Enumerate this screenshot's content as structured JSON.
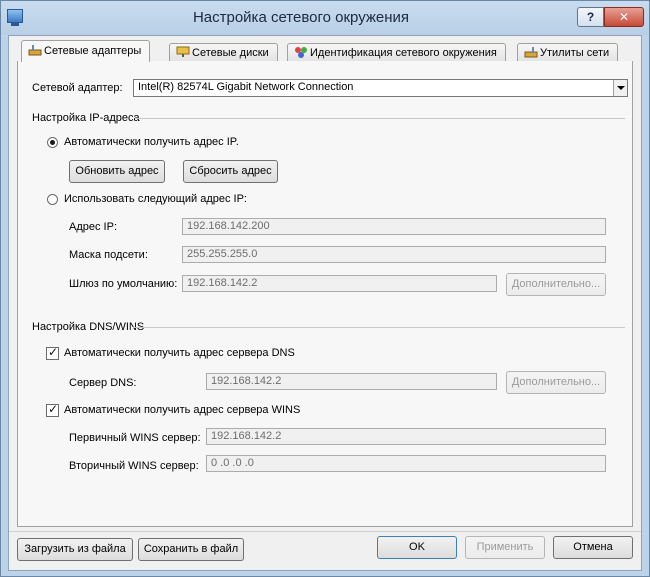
{
  "window": {
    "title": "Настройка сетевого окружения",
    "help_label": "?",
    "close_label": "✕"
  },
  "tabs": [
    {
      "label": "Сетевые адаптеры",
      "icon": "network-adapter-icon",
      "active": true
    },
    {
      "label": "Сетевые диски",
      "icon": "network-drive-icon"
    },
    {
      "label": "Идентификация сетевого окружения",
      "icon": "network-identity-icon"
    },
    {
      "label": "Утилиты сети",
      "icon": "network-tools-icon"
    }
  ],
  "adapter": {
    "label": "Сетевой адаптер:",
    "value": "Intel(R) 82574L Gigabit Network Connection"
  },
  "ip": {
    "group_title": "Настройка IP-адреса",
    "auto_label": "Автоматически получить адрес IP.",
    "auto_selected": true,
    "refresh_button": "Обновить адрес",
    "reset_button": "Сбросить адрес",
    "manual_label": "Использовать следующий адрес IP:",
    "address_label": "Адрес IP:",
    "address_value": "192.168.142.200",
    "mask_label": "Маска подсети:",
    "mask_value": "255.255.255.0",
    "gateway_label": "Шлюз по умолчанию:",
    "gateway_value": "192.168.142.2",
    "advanced_button": "Дополнительно..."
  },
  "dns": {
    "group_title": "Настройка DNS/WINS",
    "auto_dns_label": "Автоматически получить адрес сервера DNS",
    "auto_dns_checked": true,
    "dns_server_label": "Сервер DNS:",
    "dns_server_value": "192.168.142.2",
    "advanced_button": "Дополнительно...",
    "auto_wins_label": "Автоматически получить адрес сервера WINS",
    "auto_wins_checked": true,
    "primary_wins_label": "Первичный WINS сервер:",
    "primary_wins_value": "192.168.142.2",
    "secondary_wins_label": "Вторичный WINS сервер:",
    "secondary_wins_value": "0  .0  .0  .0"
  },
  "footer": {
    "load_button": "Загрузить из файла",
    "save_button": "Сохранить в файл",
    "ok_button": "OK",
    "apply_button": "Применить",
    "cancel_button": "Отмена"
  }
}
